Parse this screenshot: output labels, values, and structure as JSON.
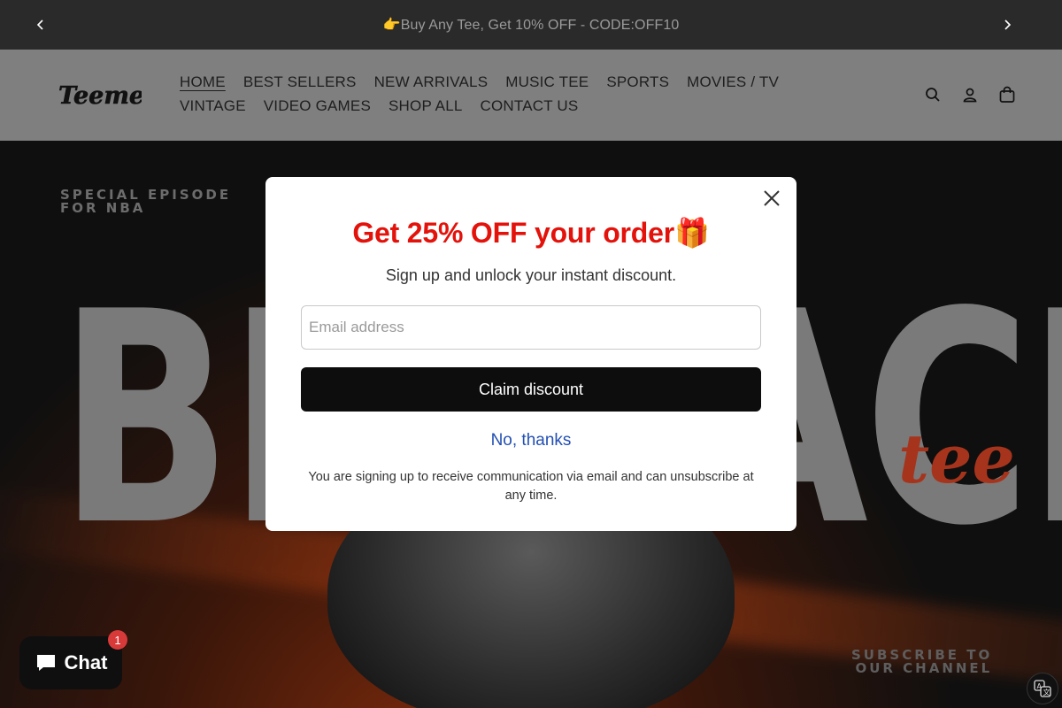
{
  "announcement": {
    "text": "👉Buy Any Tee, Get 10% OFF - CODE:OFF10",
    "prev_icon": "chevron-left-icon",
    "next_icon": "chevron-right-icon"
  },
  "header": {
    "logo_text": "Teemeey",
    "nav": [
      {
        "label": "HOME",
        "active": true
      },
      {
        "label": "BEST SELLERS"
      },
      {
        "label": "NEW ARRIVALS"
      },
      {
        "label": "MUSIC TEE"
      },
      {
        "label": "SPORTS"
      },
      {
        "label": "MOVIES / TV"
      },
      {
        "label": "VINTAGE"
      },
      {
        "label": "VIDEO GAMES"
      },
      {
        "label": "SHOP ALL"
      },
      {
        "label": "CONTACT US"
      }
    ],
    "icons": [
      "search-icon",
      "account-icon",
      "cart-icon"
    ]
  },
  "hero": {
    "episode_line1": "SPECIAL EPISODE",
    "episode_line2": "FOR NBA",
    "big_text": "BIG FACE",
    "tee_script": "tee",
    "subscribe_line1": "SUBSCRIBE TO",
    "subscribe_line2": "OUR CHANNEL"
  },
  "popup": {
    "title": "Get 25% OFF your order🎁",
    "subtitle": "Sign up and unlock your instant discount.",
    "email_placeholder": "Email address",
    "email_value": "",
    "claim_label": "Claim discount",
    "decline_label": "No, thanks",
    "legal": "You are signing up to receive communication via email and can unsubscribe at any time."
  },
  "chat": {
    "label": "Chat",
    "badge_count": "1"
  },
  "colors": {
    "accent_red": "#e3120b",
    "link_blue": "#2350b4",
    "button_black": "#0d0d0d"
  }
}
